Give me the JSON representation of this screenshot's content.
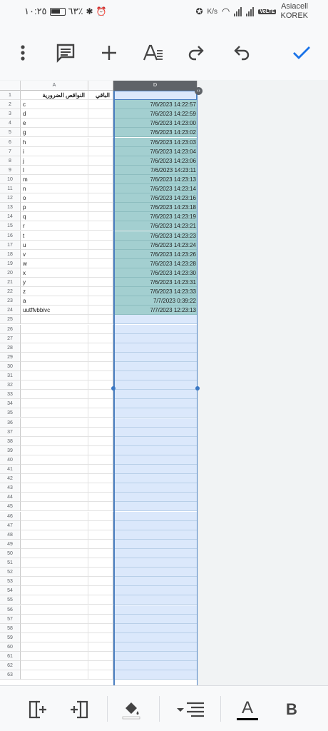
{
  "status": {
    "time": "١٠:٢٥",
    "battery": "٦٣٪",
    "speed": "K/s",
    "carrier1": "Asiacell",
    "carrier2": "KOREK",
    "volte": "VoLTE"
  },
  "toolbar": {
    "icons": [
      "more-vert-icon",
      "comment-icon",
      "add-icon",
      "text-format-icon",
      "redo-icon",
      "undo-icon",
      "check-icon"
    ]
  },
  "sheet": {
    "columns": [
      "A",
      "",
      "D"
    ],
    "header_row": {
      "a": "النواقص الضرورية",
      "b": "الباقي",
      "d": ""
    },
    "rows": [
      {
        "n": "1",
        "a": "",
        "d": ""
      },
      {
        "n": "2",
        "a": "c",
        "d": "7/6/2023 14:22:57"
      },
      {
        "n": "3",
        "a": "d",
        "d": "7/6/2023 14:22:59"
      },
      {
        "n": "4",
        "a": "e",
        "d": "7/6/2023 14:23:00"
      },
      {
        "n": "5",
        "a": "g",
        "d": "7/6/2023 14:23:02"
      },
      {
        "n": "6",
        "a": "h",
        "d": "7/6/2023 14:23:03"
      },
      {
        "n": "7",
        "a": "i",
        "d": "7/6/2023 14:23:04"
      },
      {
        "n": "8",
        "a": "j",
        "d": "7/6/2023 14:23:06"
      },
      {
        "n": "9",
        "a": "l",
        "d": "7/6/2023 14:23:11"
      },
      {
        "n": "10",
        "a": "m",
        "d": "7/6/2023 14:23:13"
      },
      {
        "n": "11",
        "a": "n",
        "d": "7/6/2023 14:23:14"
      },
      {
        "n": "12",
        "a": "o",
        "d": "7/6/2023 14:23:16"
      },
      {
        "n": "13",
        "a": "p",
        "d": "7/6/2023 14:23:18"
      },
      {
        "n": "14",
        "a": "q",
        "d": "7/6/2023 14:23:19"
      },
      {
        "n": "15",
        "a": "r",
        "d": "7/6/2023 14:23:21"
      },
      {
        "n": "16",
        "a": "t",
        "d": "7/6/2023 14:23:23"
      },
      {
        "n": "17",
        "a": "u",
        "d": "7/6/2023 14:23:24"
      },
      {
        "n": "18",
        "a": "v",
        "d": "7/6/2023 14:23:26"
      },
      {
        "n": "19",
        "a": "w",
        "d": "7/6/2023 14:23:28"
      },
      {
        "n": "20",
        "a": "x",
        "d": "7/6/2023 14:23:30"
      },
      {
        "n": "21",
        "a": "y",
        "d": "7/6/2023 14:23:31"
      },
      {
        "n": "22",
        "a": "z",
        "d": "7/6/2023 14:23:33"
      },
      {
        "n": "23",
        "a": "a",
        "d": "7/7/2023 0:39:22"
      },
      {
        "n": "24",
        "a": "uutffvbbivc",
        "d": "7/7/2023 12:23:13"
      }
    ],
    "empty_rows": [
      "25",
      "26",
      "27",
      "28",
      "29",
      "30",
      "31",
      "32",
      "33",
      "34",
      "35",
      "36",
      "37",
      "38",
      "39",
      "40",
      "41",
      "42",
      "43",
      "44",
      "45",
      "46",
      "47",
      "48",
      "49",
      "50",
      "51",
      "52",
      "53",
      "54",
      "55",
      "56",
      "57",
      "58",
      "59",
      "60",
      "61",
      "62",
      "63"
    ]
  },
  "bottombar": {
    "bold_label": "B",
    "text_color_label": "A",
    "icons": [
      "insert-column-left-icon",
      "insert-column-right-icon",
      "fill-color-icon",
      "align-icon",
      "text-color-icon",
      "bold-icon"
    ]
  },
  "colors": {
    "accent": "#1a73e8",
    "filled_cell": "#a3cfd0",
    "selected_column": "#dbe8fb",
    "header_selected": "#5f6368"
  }
}
